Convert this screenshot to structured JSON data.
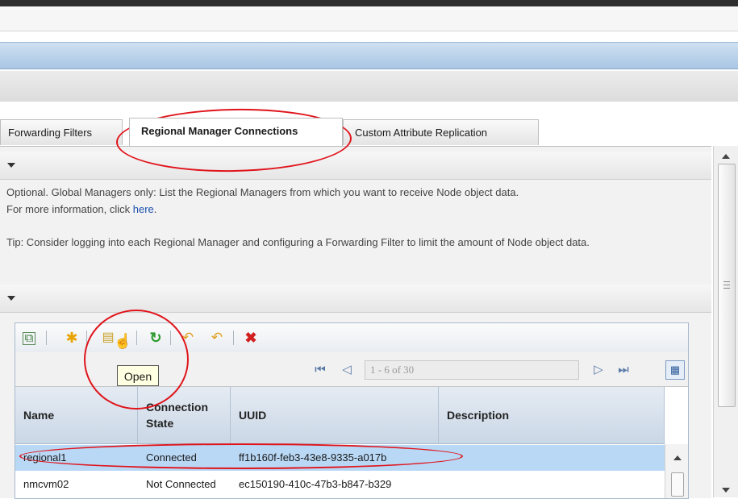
{
  "tabs": [
    {
      "label": "Forwarding Filters"
    },
    {
      "label": "Regional Manager Connections",
      "active": true
    },
    {
      "label": "Custom Attribute Replication"
    }
  ],
  "section1": {
    "line1": "Optional. Global Managers only: List the Regional Managers from which you want to receive Node object data.",
    "line2_prefix": "For more information, click ",
    "link": "here",
    "line2_suffix": ".",
    "tip": "Tip: Consider logging into each Regional Manager and configuring a Forwarding Filter to limit the amount of Node object data."
  },
  "toolbar": {
    "icons": [
      "open-in-window-icon",
      "new-icon",
      "open-icon",
      "refresh-icon",
      "undo-icon",
      "undo-all-icon",
      "delete-icon"
    ],
    "tooltip": "Open"
  },
  "pager": {
    "range": "1 - 6 of 30",
    "icons": [
      "first-page-icon",
      "previous-page-icon",
      "next-page-icon",
      "last-page-icon",
      "view-icon"
    ]
  },
  "table": {
    "columns": [
      {
        "label": "Name"
      },
      {
        "label": "Connection State"
      },
      {
        "label": "UUID"
      },
      {
        "label": "Description"
      }
    ],
    "rows": [
      {
        "name": "regional1",
        "state": "Connected",
        "uuid": "ff1b160f-feb3-43e8-9335-a017b",
        "description": "",
        "selected": true
      },
      {
        "name": "nmcvm02",
        "state": "Not Connected",
        "uuid": "ec150190-410c-47b3-b847-b329",
        "description": ""
      }
    ]
  },
  "colors": {
    "accent_blue": "#a9c6e4",
    "selection": "#b9d8f5",
    "annotation_red": "#e0141b",
    "link": "#1a4fae"
  }
}
